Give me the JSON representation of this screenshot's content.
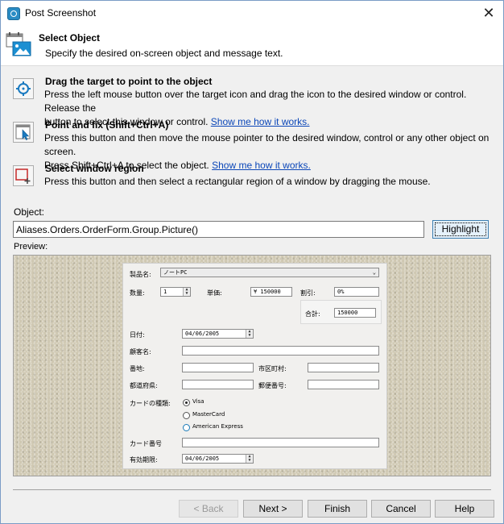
{
  "window": {
    "title": "Post Screenshot"
  },
  "header": {
    "title": "Select Object",
    "subtitle": "Specify the desired on-screen object and message text."
  },
  "options": [
    {
      "title": "Drag the target to point to the object",
      "desc1": "Press the left mouse button over the target icon and drag the icon to the desired window or control. Release the",
      "desc2": "button to select this window or control.",
      "link": "Show me how it works."
    },
    {
      "title": "Point and fix (Shift+Ctrl+A)",
      "desc1": "Press this button and then move the mouse pointer to the desired window, control or any other object on screen.",
      "desc2": "Press Shift+Ctrl+A to select the object.",
      "link": "Show me how it works."
    },
    {
      "title": "Select window region",
      "desc1": "Press this button and then select a rectangular region of a window by dragging the mouse."
    }
  ],
  "object": {
    "label": "Object:",
    "value": "Aliases.Orders.OrderForm.Group.Picture()",
    "highlight_label": "Highlight"
  },
  "preview": {
    "label": "Preview:",
    "form": {
      "product_label": "製品名:",
      "product_value": "ノートPC",
      "qty_label": "数量:",
      "qty_value": "1",
      "price_label": "単価:",
      "price_value": "¥ 150000",
      "discount_label": "割引:",
      "discount_value": "0%",
      "total_label": "合計:",
      "total_value": "150000",
      "date_label": "日付:",
      "date_value": "04/06/2005",
      "customer_label": "顧客名:",
      "address_label": "番地:",
      "city_label": "市区町村:",
      "prefecture_label": "都道府県:",
      "zip_label": "郵便番号:",
      "card_type_label": "カードの種類:",
      "card_types": [
        "Visa",
        "MasterCard",
        "American Express"
      ],
      "card_no_label": "カード番号",
      "expiry_label": "有効期限:",
      "expiry_value": "04/06/2005"
    }
  },
  "nav": {
    "back": "< Back",
    "next": "Next >",
    "finish": "Finish",
    "cancel": "Cancel",
    "help": "Help"
  }
}
